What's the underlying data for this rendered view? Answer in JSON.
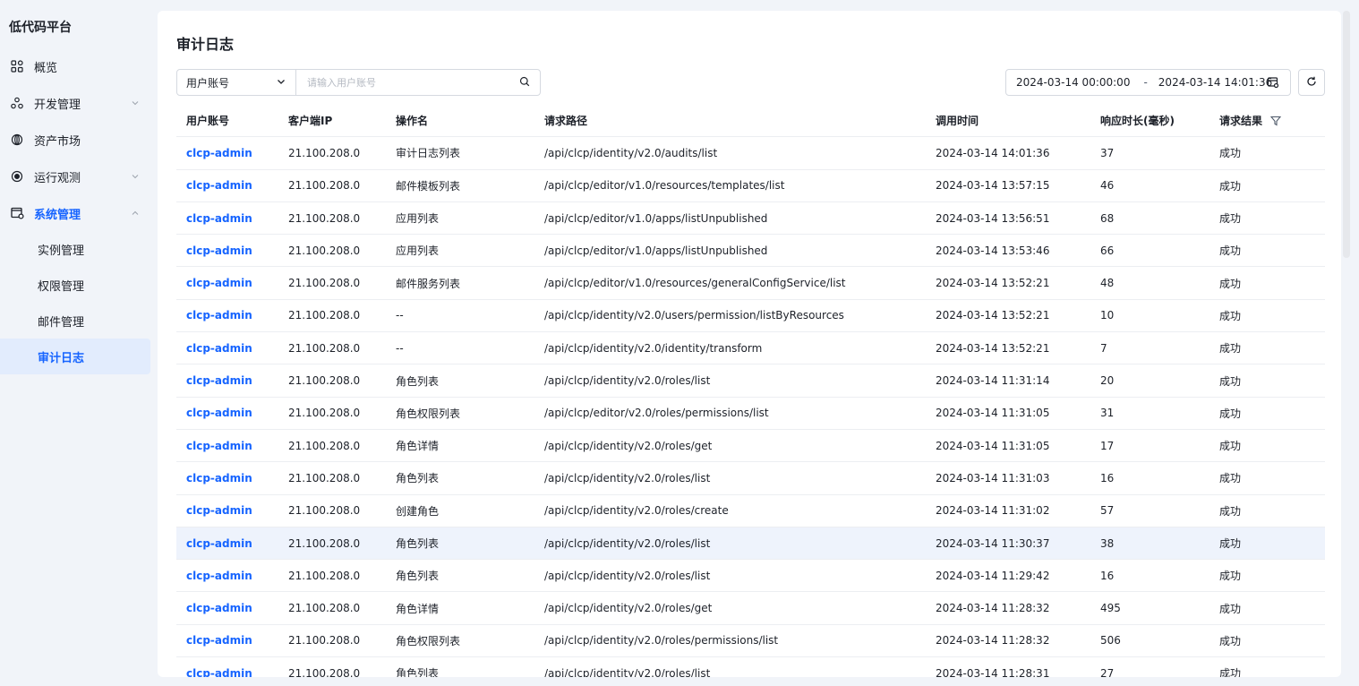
{
  "sidebar": {
    "brand": "低代码平台",
    "items": [
      {
        "label": "概览",
        "icon": "grid-icon"
      },
      {
        "label": "开发管理",
        "icon": "cluster-icon"
      },
      {
        "label": "资产市场",
        "icon": "gem-icon"
      },
      {
        "label": "运行观测",
        "icon": "eye-icon"
      },
      {
        "label": "系统管理",
        "icon": "settings-window-icon"
      }
    ],
    "sub_items": [
      {
        "label": "实例管理"
      },
      {
        "label": "权限管理"
      },
      {
        "label": "邮件管理"
      },
      {
        "label": "审计日志"
      }
    ]
  },
  "main": {
    "title": "审计日志",
    "search": {
      "field": "用户账号",
      "placeholder": "请输入用户账号"
    },
    "range": {
      "start": "2024-03-14 00:00:00",
      "separator": "-",
      "end": "2024-03-14 14:01:36"
    },
    "table": {
      "headers": [
        "用户账号",
        "客户端IP",
        "操作名",
        "请求路径",
        "调用时间",
        "响应时长(毫秒)",
        "请求结果"
      ],
      "rows": [
        [
          "clcp-admin",
          "21.100.208.0",
          "审计日志列表",
          "/api/clcp/identity/v2.0/audits/list",
          "2024-03-14 14:01:36",
          "37",
          "成功"
        ],
        [
          "clcp-admin",
          "21.100.208.0",
          "邮件模板列表",
          "/api/clcp/editor/v1.0/resources/templates/list",
          "2024-03-14 13:57:15",
          "46",
          "成功"
        ],
        [
          "clcp-admin",
          "21.100.208.0",
          "应用列表",
          "/api/clcp/editor/v1.0/apps/listUnpublished",
          "2024-03-14 13:56:51",
          "68",
          "成功"
        ],
        [
          "clcp-admin",
          "21.100.208.0",
          "应用列表",
          "/api/clcp/editor/v1.0/apps/listUnpublished",
          "2024-03-14 13:53:46",
          "66",
          "成功"
        ],
        [
          "clcp-admin",
          "21.100.208.0",
          "邮件服务列表",
          "/api/clcp/editor/v1.0/resources/generalConfigService/list",
          "2024-03-14 13:52:21",
          "48",
          "成功"
        ],
        [
          "clcp-admin",
          "21.100.208.0",
          "--",
          "/api/clcp/identity/v2.0/users/permission/listByResources",
          "2024-03-14 13:52:21",
          "10",
          "成功"
        ],
        [
          "clcp-admin",
          "21.100.208.0",
          "--",
          "/api/clcp/identity/v2.0/identity/transform",
          "2024-03-14 13:52:21",
          "7",
          "成功"
        ],
        [
          "clcp-admin",
          "21.100.208.0",
          "角色列表",
          "/api/clcp/identity/v2.0/roles/list",
          "2024-03-14 11:31:14",
          "20",
          "成功"
        ],
        [
          "clcp-admin",
          "21.100.208.0",
          "角色权限列表",
          "/api/clcp/editor/v2.0/roles/permissions/list",
          "2024-03-14 11:31:05",
          "31",
          "成功"
        ],
        [
          "clcp-admin",
          "21.100.208.0",
          "角色详情",
          "/api/clcp/identity/v2.0/roles/get",
          "2024-03-14 11:31:05",
          "17",
          "成功"
        ],
        [
          "clcp-admin",
          "21.100.208.0",
          "角色列表",
          "/api/clcp/identity/v2.0/roles/list",
          "2024-03-14 11:31:03",
          "16",
          "成功"
        ],
        [
          "clcp-admin",
          "21.100.208.0",
          "创建角色",
          "/api/clcp/identity/v2.0/roles/create",
          "2024-03-14 11:31:02",
          "57",
          "成功"
        ],
        [
          "clcp-admin",
          "21.100.208.0",
          "角色列表",
          "/api/clcp/identity/v2.0/roles/list",
          "2024-03-14 11:30:37",
          "38",
          "成功"
        ],
        [
          "clcp-admin",
          "21.100.208.0",
          "角色列表",
          "/api/clcp/identity/v2.0/roles/list",
          "2024-03-14 11:29:42",
          "16",
          "成功"
        ],
        [
          "clcp-admin",
          "21.100.208.0",
          "角色详情",
          "/api/clcp/identity/v2.0/roles/get",
          "2024-03-14 11:28:32",
          "495",
          "成功"
        ],
        [
          "clcp-admin",
          "21.100.208.0",
          "角色权限列表",
          "/api/clcp/identity/v2.0/roles/permissions/list",
          "2024-03-14 11:28:32",
          "506",
          "成功"
        ],
        [
          "clcp-admin",
          "21.100.208.0",
          "角色列表",
          "/api/clcp/identity/v2.0/roles/list",
          "2024-03-14 11:28:31",
          "27",
          "成功"
        ]
      ]
    }
  },
  "colors": {
    "accent": "#1664ff",
    "background": "#f1f4f9",
    "selected_bg": "#e2ecfd",
    "row_highlight": "#eef3fc"
  }
}
